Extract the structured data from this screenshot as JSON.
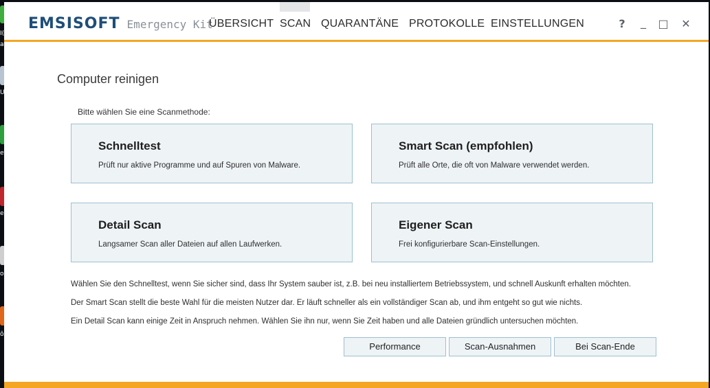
{
  "app": {
    "brand": "EMSISOFT",
    "product": "Emergency Kit",
    "accent_color": "#f5a623",
    "brand_color": "#1f4e78"
  },
  "nav": {
    "items": [
      "ÜBERSICHT",
      "SCAN",
      "QUARANTÄNE",
      "PROTOKOLLE",
      "EINSTELLUNGEN"
    ],
    "active": "SCAN"
  },
  "window_controls": {
    "help": "?",
    "minimize": "_",
    "maximize": "□",
    "close": "✕"
  },
  "page": {
    "title": "Computer reinigen",
    "prompt": "Bitte wählen Sie eine Scanmethode:"
  },
  "scan_options": [
    {
      "title": "Schnelltest",
      "description": "Prüft nur aktive Programme und auf Spuren von Malware."
    },
    {
      "title": "Smart Scan (empfohlen)",
      "description": "Prüft alle Orte, die oft von Malware verwendet werden."
    },
    {
      "title": "Detail Scan",
      "description": "Langsamer Scan aller Dateien auf allen Laufwerken."
    },
    {
      "title": "Eigener Scan",
      "description": "Frei konfigurierbare Scan-Einstellungen."
    }
  ],
  "info_lines": [
    "Wählen Sie den Schnelltest, wenn Sie sicher sind, dass Ihr System sauber ist, z.B. bei neu installiertem Betriebssystem, und schnell Auskunft erhalten möchten.",
    "Der Smart Scan stellt die beste Wahl für die meisten Nutzer dar. Er läuft schneller als ein vollständiger Scan ab, und ihm entgeht so gut wie nichts.",
    "Ein Detail Scan kann einige Zeit in Anspruch nehmen. Wählen Sie ihn nur, wenn Sie Zeit haben und alle Dateien gründlich untersuchen möchten."
  ],
  "buttons": {
    "performance": "Performance",
    "exclusions": "Scan-Ausnahmen",
    "on_finish": "Bei Scan-Ende"
  },
  "desktop": {
    "labels": [
      "I(",
      "al",
      "U",
      "ef",
      "e",
      "oe",
      "ôz"
    ]
  }
}
